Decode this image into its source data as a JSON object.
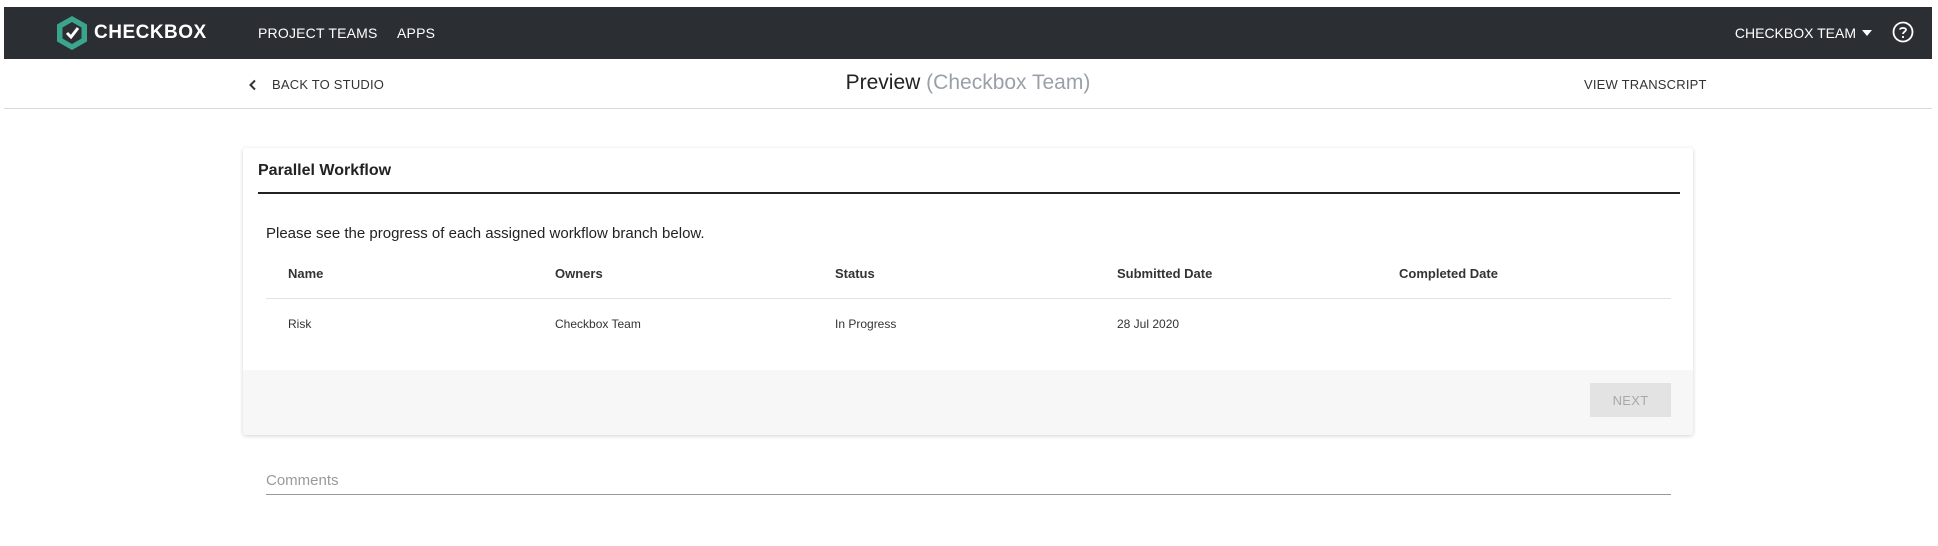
{
  "topbar": {
    "logo_text": "CHECKBOX",
    "nav": [
      "PROJECT TEAMS",
      "APPS"
    ],
    "team_menu": "CHECKBOX TEAM",
    "colors": {
      "background": "#2b2f33",
      "logo_accent": "#3aa58c"
    }
  },
  "subheader": {
    "back_label": "BACK TO STUDIO",
    "title": "Preview",
    "title_team": "(Checkbox Team)",
    "view_transcript": "VIEW TRANSCRIPT"
  },
  "card": {
    "title": "Parallel Workflow",
    "intro": "Please see the progress of each assigned workflow branch below.",
    "table": {
      "columns": [
        "Name",
        "Owners",
        "Status",
        "Submitted Date",
        "Completed Date"
      ],
      "rows": [
        [
          "Risk",
          "Checkbox Team",
          "In Progress",
          "28 Jul 2020",
          ""
        ]
      ]
    },
    "next_label": "NEXT"
  },
  "comments": {
    "placeholder": "Comments",
    "value": ""
  }
}
